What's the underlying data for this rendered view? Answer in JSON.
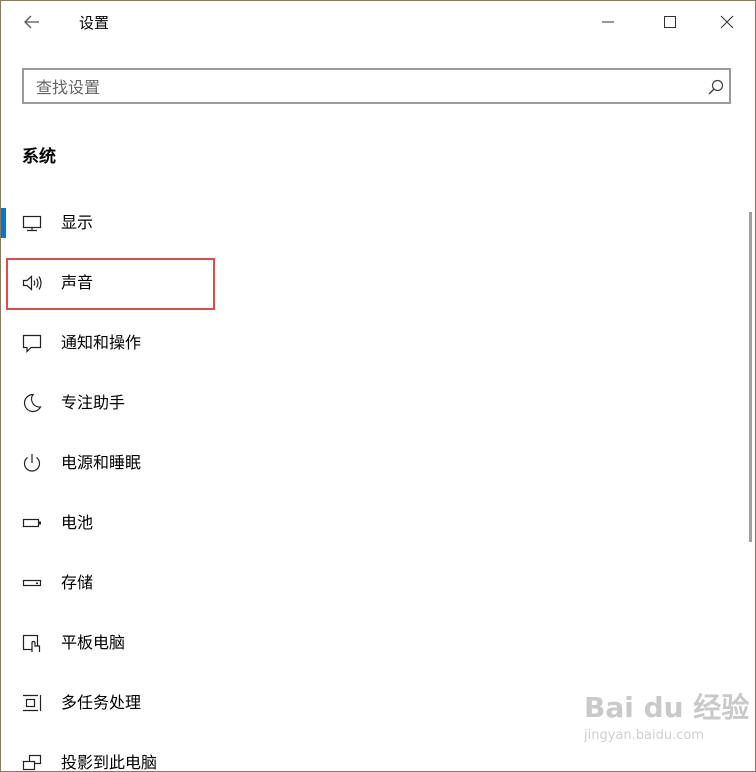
{
  "window": {
    "title": "设置"
  },
  "search": {
    "placeholder": "查找设置"
  },
  "section": {
    "title": "系统"
  },
  "nav": {
    "items": [
      {
        "label": "显示",
        "icon": "monitor-icon",
        "active": true
      },
      {
        "label": "声音",
        "icon": "speaker-icon",
        "highlighted": true
      },
      {
        "label": "通知和操作",
        "icon": "notification-icon"
      },
      {
        "label": "专注助手",
        "icon": "moon-icon"
      },
      {
        "label": "电源和睡眠",
        "icon": "power-icon"
      },
      {
        "label": "电池",
        "icon": "battery-icon"
      },
      {
        "label": "存储",
        "icon": "storage-icon"
      },
      {
        "label": "平板电脑",
        "icon": "tablet-icon"
      },
      {
        "label": "多任务处理",
        "icon": "multitasking-icon"
      },
      {
        "label": "投影到此电脑",
        "icon": "projection-icon"
      }
    ]
  },
  "watermark": {
    "logo": "Bai du 经验",
    "url": "jingyan.baidu.com"
  },
  "colors": {
    "accent": "#0078d7",
    "highlight": "#e14a4a"
  }
}
